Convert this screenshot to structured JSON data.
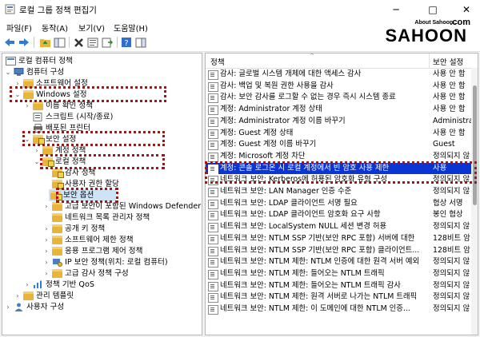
{
  "window": {
    "title": "로컬 그룹 정책 편집기",
    "minimize": "─",
    "maximize": "□",
    "close": "✕"
  },
  "menu": [
    "파일(F)",
    "동작(A)",
    "보기(V)",
    "도움말(H)"
  ],
  "toolbar_icons": [
    "back-icon",
    "forward-icon",
    "up-folder-icon",
    "show-hide-tree-icon",
    "delete-icon",
    "properties-icon",
    "export-list-icon",
    "help-icon",
    "show-pane-icon"
  ],
  "watermark": {
    "small": "About Sahoon...",
    "main": "SAHOON",
    "com": ".com"
  },
  "tree": [
    {
      "label": "로컬 컴퓨터 정책",
      "icon": "computer-policy-icon",
      "arrow": ""
    },
    {
      "label": "컴퓨터 구성",
      "icon": "computer-icon",
      "arrow": "⌄"
    },
    {
      "label": "소프트웨어 설정",
      "icon": "folder-icon",
      "arrow": "›"
    },
    {
      "label": "Windows 설정",
      "icon": "folder-icon",
      "arrow": "⌄"
    },
    {
      "label": "이름 확인 정책",
      "icon": "folder-icon",
      "arrow": "›"
    },
    {
      "label": "스크립트 (시작/종료)",
      "icon": "script-icon",
      "arrow": ""
    },
    {
      "label": "배포된 프린터",
      "icon": "printer-icon",
      "arrow": ""
    },
    {
      "label": "보안 설정",
      "icon": "security-icon",
      "arrow": "⌄"
    },
    {
      "label": "계정 정책",
      "icon": "folder-icon",
      "arrow": "›"
    },
    {
      "label": "로컬 정책",
      "icon": "folder-icon",
      "arrow": "⌄"
    },
    {
      "label": "감사 정책",
      "icon": "folder-icon",
      "arrow": ""
    },
    {
      "label": "사용자 권한 할당",
      "icon": "folder-icon",
      "arrow": ""
    },
    {
      "label": "보안 옵션",
      "icon": "folder-icon",
      "arrow": ""
    },
    {
      "label": "고급 보안이 포함된 Windows Defender",
      "icon": "folder-icon",
      "arrow": "›"
    },
    {
      "label": "네트워크 목록 관리자 정책",
      "icon": "folder-icon",
      "arrow": ""
    },
    {
      "label": "공개 키 정책",
      "icon": "folder-icon",
      "arrow": "›"
    },
    {
      "label": "소프트웨어 제한 정책",
      "icon": "folder-icon",
      "arrow": "›"
    },
    {
      "label": "응용 프로그램 제어 정책",
      "icon": "folder-icon",
      "arrow": "›"
    },
    {
      "label": "IP 보안 정책(위치: 로컬 컴퓨터)",
      "icon": "ip-security-icon",
      "arrow": "›"
    },
    {
      "label": "고급 감사 정책 구성",
      "icon": "folder-icon",
      "arrow": "›"
    },
    {
      "label": "정책 기반 QoS",
      "icon": "qos-icon",
      "arrow": "›"
    },
    {
      "label": "관리 템플릿",
      "icon": "folder-icon",
      "arrow": "›"
    },
    {
      "label": "사용자 구성",
      "icon": "user-icon",
      "arrow": "›"
    }
  ],
  "list": {
    "col_policy": "정책",
    "col_setting": "보안 설정",
    "rows": [
      {
        "policy": "감사: 글로벌 시스템 개체에 대한 액세스 감사",
        "setting": "사용 안 함"
      },
      {
        "policy": "감사: 백업 및 복원 권한 사용을 감사",
        "setting": "사용 안 함"
      },
      {
        "policy": "감사: 보안 감사를 로그할 수 없는 경우 즉시 시스템 종료",
        "setting": "사용 안 함"
      },
      {
        "policy": "계정: Administrator 계정 상태",
        "setting": "사용 안 함"
      },
      {
        "policy": "계정: Administrator 계정 이름 바꾸기",
        "setting": "Administrat"
      },
      {
        "policy": "계정: Guest 계정 상태",
        "setting": "사용 안 함"
      },
      {
        "policy": "계정: Guest 계정 이름 바꾸기",
        "setting": "Guest"
      },
      {
        "policy": "계정: Microsoft 계정 차단",
        "setting": "정의되지 않"
      },
      {
        "policy": "계정: 콘솔 로그온 시 로컬 계정에서 빈 암호 사용 제한",
        "setting": "사용"
      },
      {
        "policy": "네트워크 보안: Kerberos에 허용된 암호화 유형 구성",
        "setting": "정의되지 않"
      },
      {
        "policy": "네트워크 보안: LAN Manager 인증 수준",
        "setting": "정의되지 않"
      },
      {
        "policy": "네트워크 보안: LDAP 클라이언트 서명 필요",
        "setting": "협상 서명"
      },
      {
        "policy": "네트워크 보안: LDAP 클라이언트 암호화 요구 사항",
        "setting": "봉인 협상"
      },
      {
        "policy": "네트워크 보안: LocalSystem NULL 세션 변경 허용",
        "setting": "정의되지 않"
      },
      {
        "policy": "네트워크 보안: NTLM SSP 기반(보안 RPC 포함) 서버에 대한",
        "setting": "128비트 암"
      },
      {
        "policy": "네트워크 보안: NTLM SSP 기반(보안 RPC 포함) 클라이언트...",
        "setting": "128비트 암"
      },
      {
        "policy": "네트워크 보안: NTLM 제한: NTLM 인증에 대한 원격 서버 예외",
        "setting": "정의되지 않"
      },
      {
        "policy": "네트워크 보안: NTLM 제한: 들어오는 NTLM 트래픽",
        "setting": "정의되지 않"
      },
      {
        "policy": "네트워크 보안: NTLM 제한: 들어오는 NTLM 트래픽 감사",
        "setting": "정의되지 않"
      },
      {
        "policy": "네트워크 보안: NTLM 제한: 원격 서버로 나가는 NTLM 트래픽",
        "setting": "정의되지 않"
      },
      {
        "policy": "네트워크 보안: NTLM 제한: 이 도메인에 대한 NTLM 인증...",
        "setting": "정의되지 않"
      }
    ]
  }
}
